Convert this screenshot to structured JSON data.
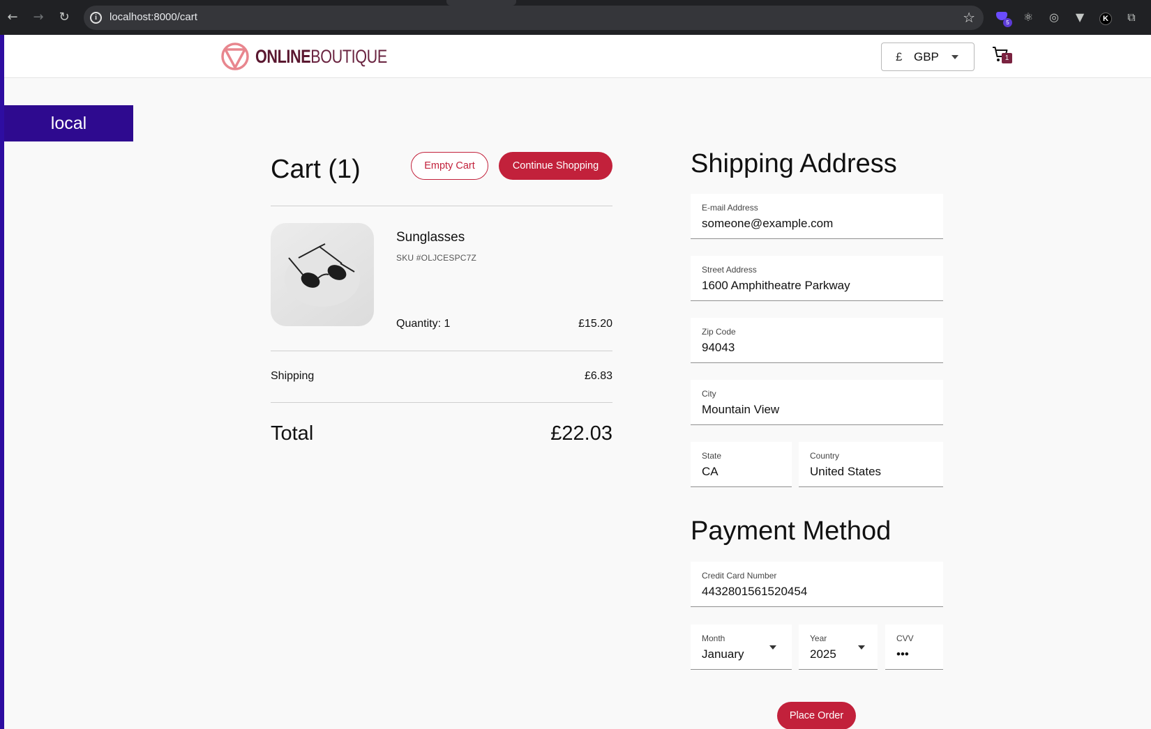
{
  "browser": {
    "url": "localhost:8000/cart",
    "extension_badge": "5",
    "extension_letter": "K"
  },
  "header": {
    "logo_bold": "ONLINE",
    "logo_thin": "BOUTIQUE",
    "currency_symbol": "£",
    "currency_code": "GBP",
    "cart_count": "1"
  },
  "env_badge": "local",
  "cart": {
    "title": "Cart (1)",
    "empty_label": "Empty Cart",
    "continue_label": "Continue Shopping",
    "item": {
      "name": "Sunglasses",
      "sku": "SKU #OLJCESPC7Z",
      "quantity": "Quantity: 1",
      "price": "£15.20"
    },
    "shipping_label": "Shipping",
    "shipping_value": "£6.83",
    "total_label": "Total",
    "total_value": "£22.03"
  },
  "shipping_address": {
    "title": "Shipping Address",
    "email": {
      "label": "E-mail Address",
      "value": "someone@example.com"
    },
    "street": {
      "label": "Street Address",
      "value": "1600 Amphitheatre Parkway"
    },
    "zip": {
      "label": "Zip Code",
      "value": "94043"
    },
    "city": {
      "label": "City",
      "value": "Mountain View"
    },
    "state": {
      "label": "State",
      "value": "CA"
    },
    "country": {
      "label": "Country",
      "value": "United States"
    }
  },
  "payment": {
    "title": "Payment Method",
    "card": {
      "label": "Credit Card Number",
      "value": "4432801561520454"
    },
    "month": {
      "label": "Month",
      "value": "January"
    },
    "year": {
      "label": "Year",
      "value": "2025"
    },
    "cvv": {
      "label": "CVV",
      "value": "•••"
    },
    "place_order_label": "Place Order"
  },
  "colors": {
    "brand_red": "#c2213b",
    "env_badge_bg": "#2e0a8f",
    "logo_color": "#5a1830",
    "logo_mark": "#e8868e"
  }
}
